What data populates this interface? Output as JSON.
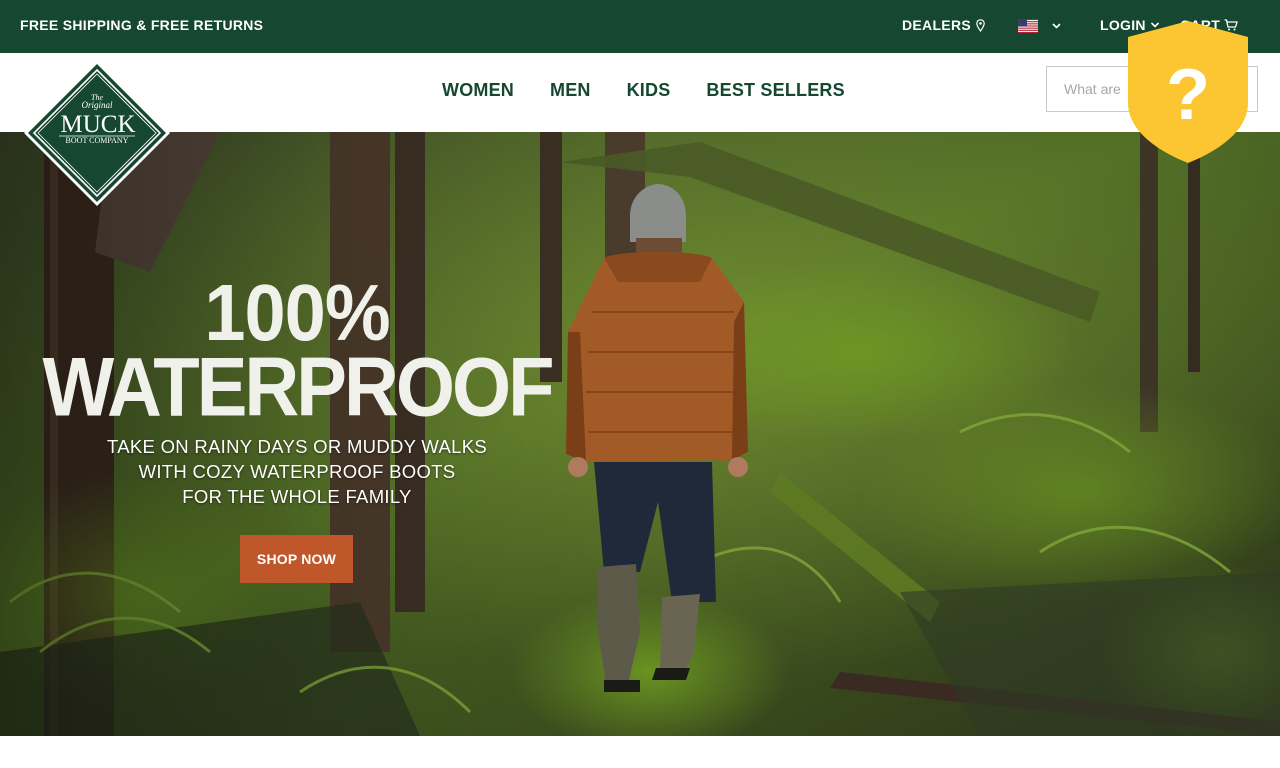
{
  "topbar": {
    "promo": "FREE SHIPPING & FREE RETURNS",
    "dealers": "DEALERS",
    "login": "LOGIN",
    "cart": "CART",
    "region_icon": "us-flag-icon"
  },
  "logo": {
    "line1": "The",
    "line2": "Original",
    "line3": "MUCK",
    "line4": "BOOT COMPANY"
  },
  "nav": {
    "items": [
      "WOMEN",
      "MEN",
      "KIDS",
      "BEST SELLERS"
    ]
  },
  "search": {
    "placeholder": "What are"
  },
  "hero": {
    "headline_1": "100%",
    "headline_2": "WATERPROOF",
    "subhead_1": "TAKE ON RAINY DAYS OR MUDDY WALKS",
    "subhead_2": "WITH COZY WATERPROOF BOOTS",
    "subhead_3": "FOR THE WHOLE FAMILY",
    "cta": "SHOP NOW"
  },
  "help_badge": {
    "symbol": "?"
  },
  "colors": {
    "brand_green": "#154731",
    "cta_orange": "#c0572a",
    "badge_yellow": "#fbc631"
  }
}
